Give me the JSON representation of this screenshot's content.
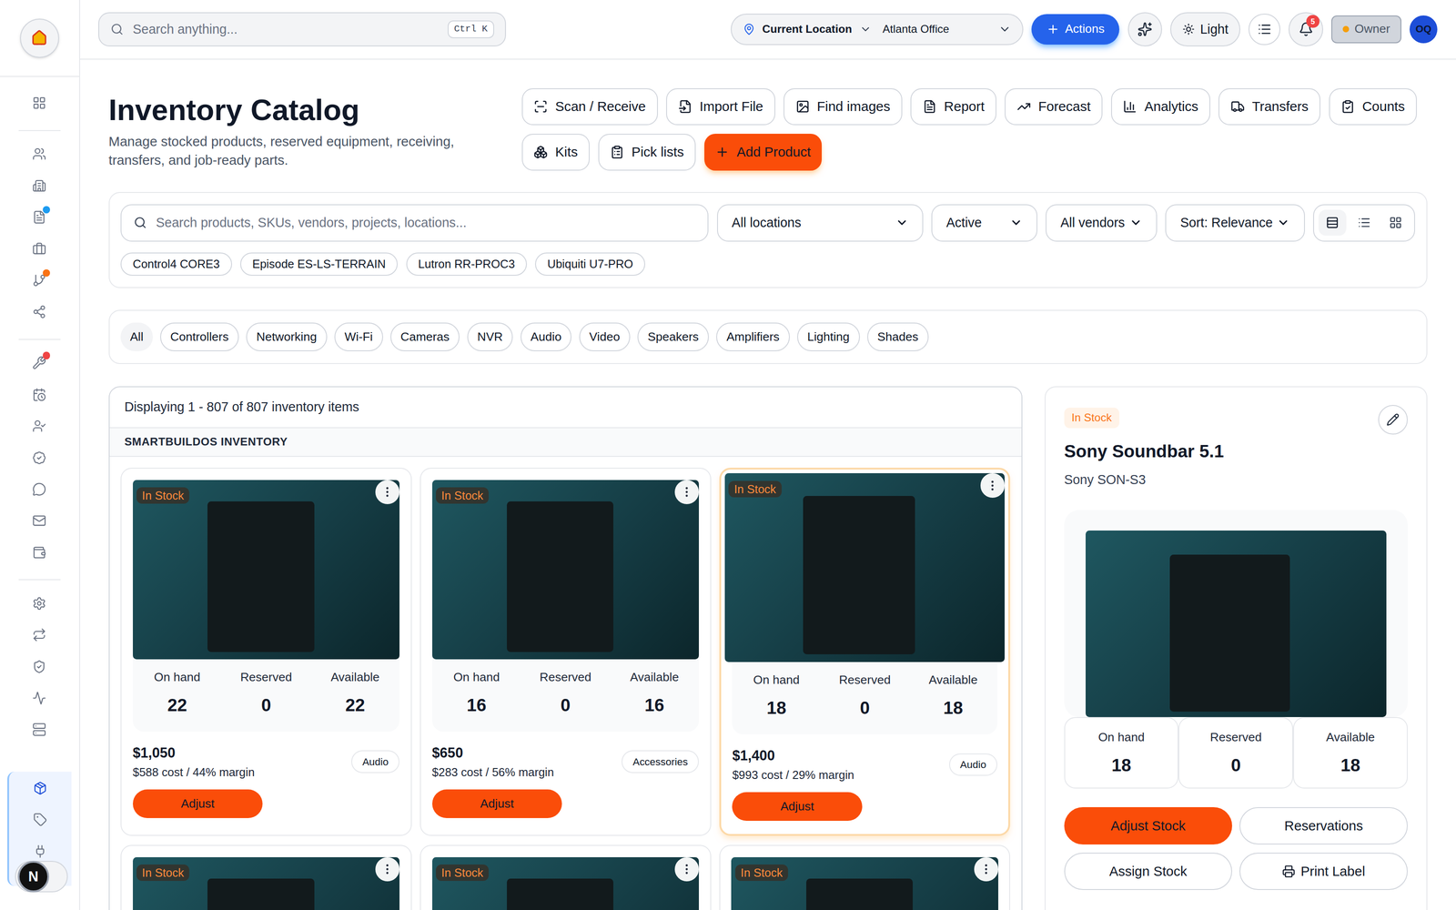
{
  "sidebar": {
    "groups": [
      [
        {
          "selected": false,
          "dot": null
        }
      ],
      [
        {
          "selected": false,
          "dot": null
        },
        {
          "selected": false,
          "dot": null
        },
        {
          "selected": false,
          "dot": "#1d9bf0"
        },
        {
          "selected": false,
          "dot": null
        },
        {
          "selected": false,
          "dot": "#f97316"
        },
        {
          "selected": false,
          "dot": null
        }
      ],
      [
        {
          "selected": false,
          "dot": "#ef4444"
        },
        {
          "selected": false,
          "dot": null
        },
        {
          "selected": false,
          "dot": null
        },
        {
          "selected": false,
          "dot": null
        },
        {
          "selected": false,
          "dot": null
        },
        {
          "selected": false,
          "dot": null
        },
        {
          "selected": false,
          "dot": null
        }
      ],
      [
        {
          "selected": false,
          "dot": null
        },
        {
          "selected": false,
          "dot": null
        },
        {
          "selected": false,
          "dot": null
        },
        {
          "selected": false,
          "dot": null
        },
        {
          "selected": false,
          "dot": null
        }
      ],
      [
        {
          "selected": true,
          "dot": null
        },
        {
          "selected": false,
          "dot": null
        },
        {
          "selected": false,
          "dot": null
        }
      ]
    ],
    "dev_indicator": "N"
  },
  "topbar": {
    "search_placeholder": "Search anything...",
    "shortcut": "Ctrl K",
    "location_label": "Current Location",
    "location_value": "Atlanta Office",
    "actions": "Actions",
    "theme": "Light",
    "notifications": "5",
    "role": "Owner",
    "avatar": "OQ"
  },
  "header": {
    "title": "Inventory Catalog",
    "subtitle": "Manage stocked products, reserved equipment, receiving, transfers, and job-ready parts.",
    "buttons": [
      {
        "label": "Scan / Receive",
        "primary": false
      },
      {
        "label": "Import File",
        "primary": false
      },
      {
        "label": "Find images",
        "primary": false
      },
      {
        "label": "Report",
        "primary": false
      },
      {
        "label": "Forecast",
        "primary": false
      },
      {
        "label": "Analytics",
        "primary": false
      },
      {
        "label": "Transfers",
        "primary": false
      },
      {
        "label": "Counts",
        "primary": false
      },
      {
        "label": "Kits",
        "primary": false
      },
      {
        "label": "Pick lists",
        "primary": false
      },
      {
        "label": "Add Product",
        "primary": true
      }
    ]
  },
  "filters": {
    "search_placeholder": "Search products, SKUs, vendors, projects, locations...",
    "selects": [
      "All locations",
      "Active",
      "All vendors",
      "Sort: Relevance"
    ],
    "views": [
      {
        "selected": true
      },
      {
        "selected": false
      },
      {
        "selected": false
      }
    ],
    "chips": [
      "Control4 CORE3",
      "Episode ES-LS-TERRAIN",
      "Lutron RR-PROC3",
      "Ubiquiti U7-PRO"
    ]
  },
  "categories": [
    {
      "label": "All",
      "selected": true
    },
    {
      "label": "Controllers",
      "selected": false
    },
    {
      "label": "Networking",
      "selected": false
    },
    {
      "label": "Wi-Fi",
      "selected": false
    },
    {
      "label": "Cameras",
      "selected": false
    },
    {
      "label": "NVR",
      "selected": false
    },
    {
      "label": "Audio",
      "selected": false
    },
    {
      "label": "Video",
      "selected": false
    },
    {
      "label": "Speakers",
      "selected": false
    },
    {
      "label": "Amplifiers",
      "selected": false
    },
    {
      "label": "Lighting",
      "selected": false
    },
    {
      "label": "Shades",
      "selected": false
    }
  ],
  "grid": {
    "summary": "Displaying 1 - 807 of 807 inventory items",
    "group": "SMARTBUILDOS INVENTORY",
    "cards": [
      {
        "kind": "full",
        "status": "In Stock",
        "stats": [
          {
            "label": "On hand",
            "value": "22"
          },
          {
            "label": "Reserved",
            "value": "0"
          },
          {
            "label": "Available",
            "value": "22"
          }
        ],
        "price": "$1,050",
        "cost": "$588 cost / 44% margin",
        "category": "Audio",
        "button": "Adjust",
        "selected": false
      },
      {
        "kind": "full",
        "status": "In Stock",
        "stats": [
          {
            "label": "On hand",
            "value": "16"
          },
          {
            "label": "Reserved",
            "value": "0"
          },
          {
            "label": "Available",
            "value": "16"
          }
        ],
        "price": "$650",
        "cost": "$283 cost / 56% margin",
        "category": "Accessories",
        "button": "Adjust",
        "selected": false
      },
      {
        "kind": "full",
        "status": "In Stock",
        "stats": [
          {
            "label": "On hand",
            "value": "18"
          },
          {
            "label": "Reserved",
            "value": "0"
          },
          {
            "label": "Available",
            "value": "18"
          }
        ],
        "price": "$1,400",
        "cost": "$993 cost / 29% margin",
        "category": "Audio",
        "button": "Adjust",
        "selected": true
      },
      {
        "kind": "partial",
        "status": "In Stock",
        "selected": false
      },
      {
        "kind": "partial",
        "status": "In Stock",
        "selected": false
      },
      {
        "kind": "partial",
        "status": "In Stock",
        "selected": false
      }
    ]
  },
  "detail": {
    "status": "In Stock",
    "title": "Sony Soundbar 5.1",
    "sku": "Sony SON-S3",
    "stats": [
      {
        "label": "On hand",
        "value": "18"
      },
      {
        "label": "Reserved",
        "value": "0"
      },
      {
        "label": "Available",
        "value": "18"
      }
    ],
    "buttons": [
      {
        "label": "Adjust Stock",
        "primary": true
      },
      {
        "label": "Reservations",
        "primary": false
      },
      {
        "label": "Assign Stock",
        "primary": false
      },
      {
        "label": "Print Label",
        "primary": false
      }
    ]
  }
}
